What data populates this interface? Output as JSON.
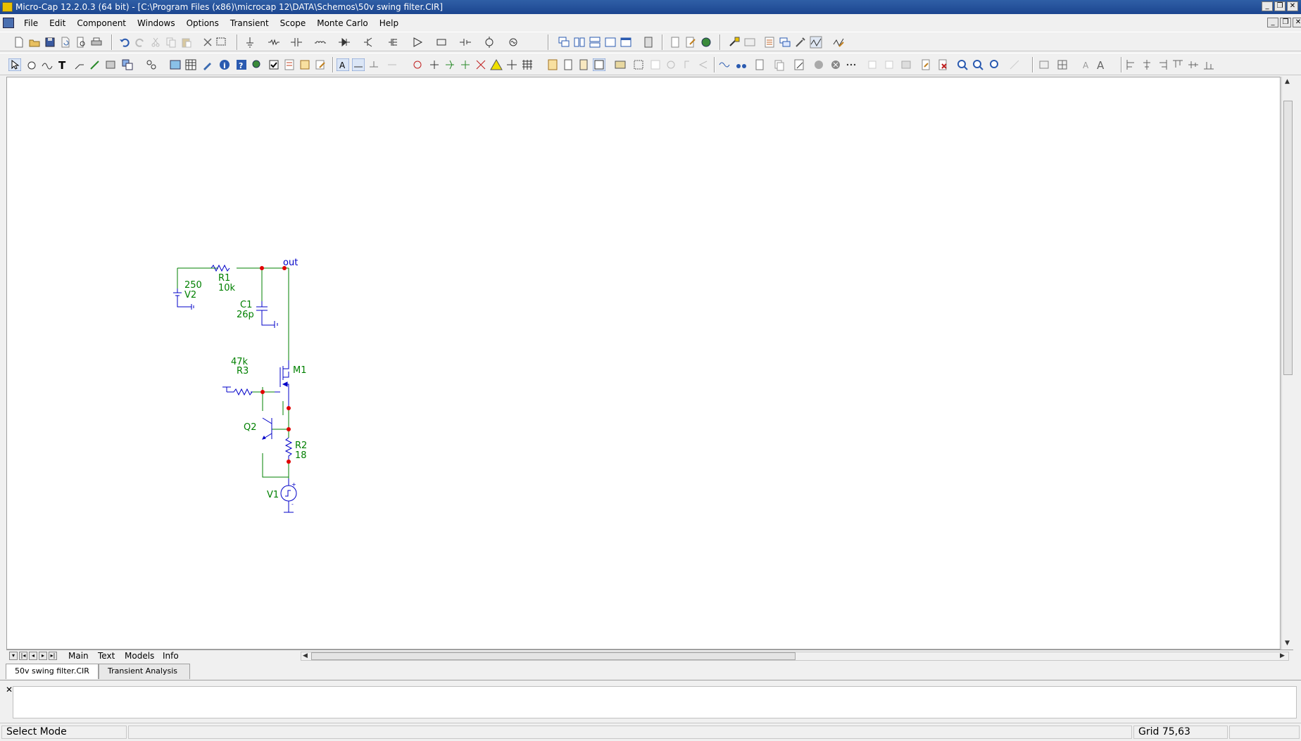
{
  "window": {
    "title": "Micro-Cap 12.2.0.3 (64 bit) - [C:\\Program Files (x86)\\microcap 12\\DATA\\Schemos\\50v swing filter.CIR]"
  },
  "menu": [
    "File",
    "Edit",
    "Component",
    "Windows",
    "Options",
    "Transient",
    "Scope",
    "Monte Carlo",
    "Help"
  ],
  "schematic": {
    "components": {
      "v2": {
        "name": "V2",
        "value": "250"
      },
      "r1": {
        "name": "R1",
        "value": "10k"
      },
      "c1": {
        "name": "C1",
        "value": "26p"
      },
      "out": {
        "label": "out"
      },
      "r3": {
        "name": "R3",
        "value": "47k"
      },
      "m1": {
        "name": "M1"
      },
      "q2": {
        "name": "Q2"
      },
      "r2": {
        "name": "R2",
        "value": "18"
      },
      "v1": {
        "name": "V1"
      }
    },
    "colors": {
      "wire": "#008000",
      "component": "#0000c8",
      "node": "#e00000",
      "label": "#008000"
    }
  },
  "sheet_tabs": [
    "Main",
    "Text",
    "Models",
    "Info"
  ],
  "doc_tabs": [
    "50v swing filter.CIR",
    "Transient Analysis"
  ],
  "status": {
    "mode": "Select Mode",
    "grid": "Grid 75,63"
  }
}
